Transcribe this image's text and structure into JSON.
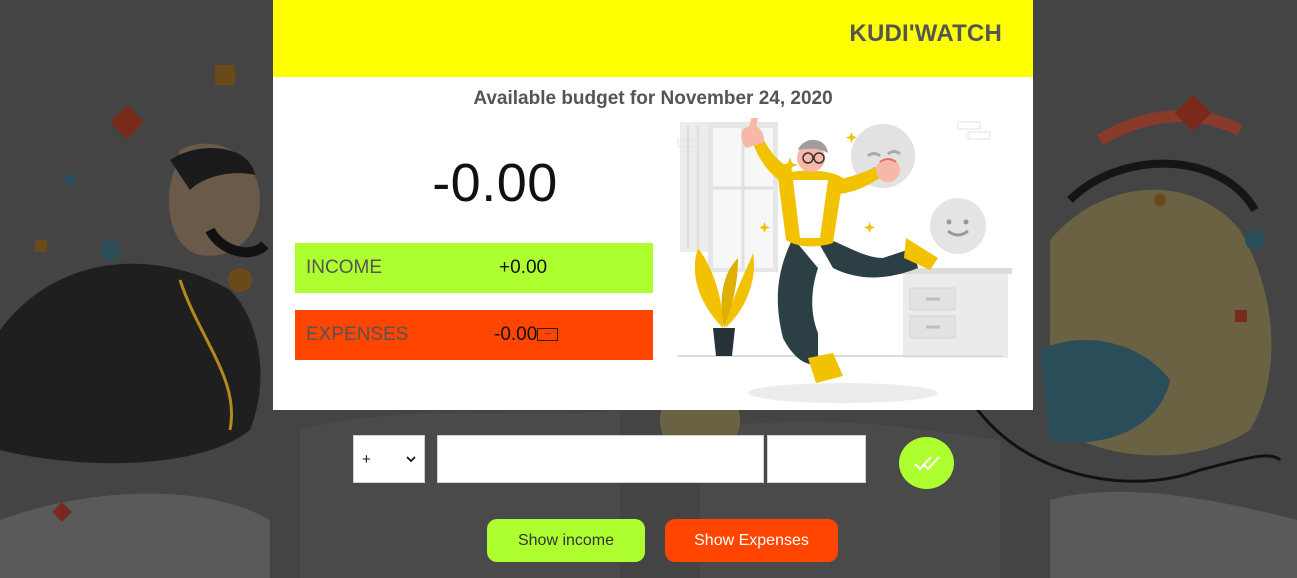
{
  "app": {
    "brand": "KUDI'WATCH"
  },
  "budget": {
    "title": "Available budget for November 24, 2020",
    "value": "-0.00"
  },
  "income": {
    "label": "INCOME",
    "value": "+0.00"
  },
  "expenses": {
    "label": "EXPENSES",
    "value": "-0.00",
    "percentage": "---"
  },
  "form": {
    "type_selected": "+",
    "type_options": [
      "+"
    ],
    "description_value": "",
    "value_value": "",
    "add_icon": "double-check-icon"
  },
  "buttons": {
    "show_income": "Show income",
    "show_expenses": "Show Expenses"
  },
  "colors": {
    "header": "#ffff00",
    "income": "#adff2f",
    "expenses": "#ff4500"
  }
}
